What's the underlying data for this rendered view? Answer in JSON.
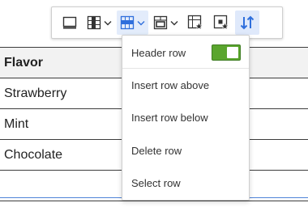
{
  "toolbar": {
    "buttons": [
      {
        "name": "table-properties-icon"
      },
      {
        "name": "column-icon"
      },
      {
        "name": "row-icon"
      },
      {
        "name": "merge-cells-icon"
      },
      {
        "name": "table-cell-properties-icon"
      },
      {
        "name": "cell-properties-icon"
      },
      {
        "name": "sort-icon"
      }
    ]
  },
  "table": {
    "header": "Flavor",
    "rows": [
      "Strawberry",
      "Mint",
      "Chocolate",
      ""
    ]
  },
  "row_menu": {
    "items": [
      {
        "label": "Header row",
        "toggle": true
      },
      {
        "label": "Insert row above"
      },
      {
        "label": "Insert row below"
      },
      {
        "label": "Delete row"
      },
      {
        "label": "Select row"
      }
    ]
  },
  "colors": {
    "accent": "#4f83d8",
    "switch_on": "#5aa52e",
    "icon": "#333333",
    "active_icon": "#2f6fdc"
  }
}
